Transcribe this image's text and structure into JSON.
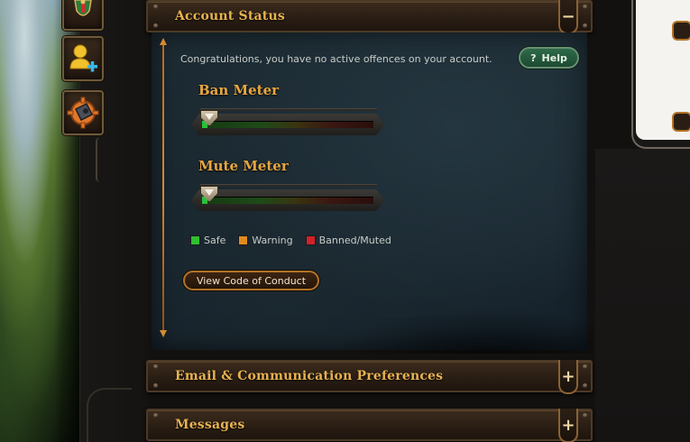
{
  "sidebar": {
    "icons": [
      {
        "name": "shield-crest-icon"
      },
      {
        "name": "add-friend-icon"
      },
      {
        "name": "settings-gear-icon"
      }
    ]
  },
  "account_status": {
    "title": "Account Status",
    "toggle": "−",
    "intro": "Congratulations, you have no active offences on your account.",
    "help_label": "Help",
    "help_icon": "?",
    "ban_meter": {
      "label": "Ban Meter",
      "level": 0
    },
    "mute_meter": {
      "label": "Mute Meter",
      "level": 0
    },
    "legend": [
      {
        "label": "Safe",
        "color": "#2fbf2f"
      },
      {
        "label": "Warning",
        "color": "#e08a1e"
      },
      {
        "label": "Banned/Muted",
        "color": "#d0212a"
      }
    ],
    "code_of_conduct_label": "View Code of Conduct"
  },
  "email_prefs": {
    "title": "Email & Communication Preferences",
    "toggle": "+"
  },
  "messages": {
    "title": "Messages",
    "toggle": "+"
  },
  "colors": {
    "accent": "#e8b251",
    "panel_bg": "#1a2730",
    "help_green": "#1c4a31"
  }
}
